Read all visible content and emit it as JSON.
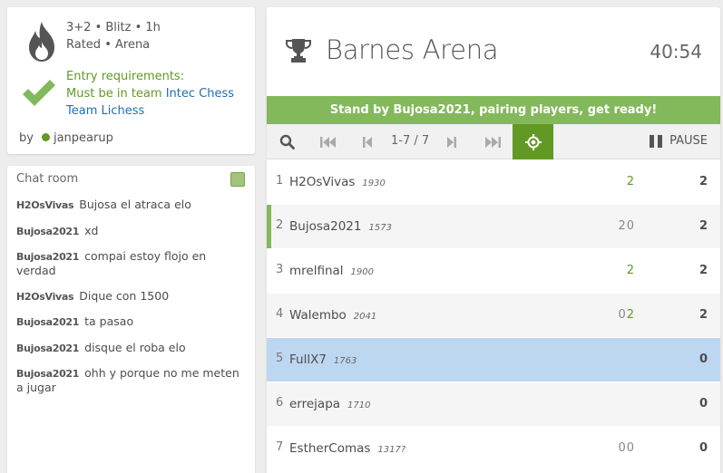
{
  "tournament": {
    "clock_line": "3+2 • Blitz • 1h",
    "mode_line": "Rated • Arena",
    "entry": {
      "label": "Entry requirements:",
      "prefix": "Must be in team",
      "team_line1": "Intec Chess",
      "team_line2": "Team Lichess"
    },
    "by_label": "by",
    "creator": "janpearup",
    "name": "Barnes Arena",
    "time_left": "40:54",
    "banner": "Stand by Bujosa2021, pairing players, get ready!",
    "page_info": "1-7 / 7",
    "pause_label": "PAUSE"
  },
  "chat": {
    "title": "Chat room",
    "messages": [
      {
        "user": "H2OsVivas",
        "text": "Bujosa el atraca elo"
      },
      {
        "user": "Bujosa2021",
        "text": "xd"
      },
      {
        "user": "Bujosa2021",
        "text": "compai estoy flojo en verdad"
      },
      {
        "user": "H2OsVivas",
        "text": "Dique con 1500"
      },
      {
        "user": "Bujosa2021",
        "text": "ta pasao"
      },
      {
        "user": "Bujosa2021",
        "text": "disque el roba elo"
      },
      {
        "user": "Bujosa2021",
        "text": "ohh y porque no me meten a jugar"
      }
    ]
  },
  "standings": [
    {
      "rank": "1",
      "name": "H2OsVivas",
      "rating": "1930",
      "sheet": "2",
      "score": "2"
    },
    {
      "rank": "2",
      "name": "Bujosa2021",
      "rating": "1573",
      "sheet": "20",
      "score": "2"
    },
    {
      "rank": "3",
      "name": "mrelfinal",
      "rating": "1900",
      "sheet": "2",
      "score": "2"
    },
    {
      "rank": "4",
      "name": "Walembo",
      "rating": "2041",
      "sheet": "02",
      "score": "2"
    },
    {
      "rank": "5",
      "name": "FullX7",
      "rating": "1763",
      "sheet": "",
      "score": "0"
    },
    {
      "rank": "6",
      "name": "errejapa",
      "rating": "1710",
      "sheet": "",
      "score": "0"
    },
    {
      "rank": "7",
      "name": "EstherComas",
      "rating": "1317?",
      "sheet": "00",
      "score": "0"
    }
  ],
  "colors": {
    "accent": "#629924",
    "banner": "#83b85b",
    "highlight": "#bdd7f1",
    "link": "#1f6fb2"
  },
  "icons": [
    "flame-icon",
    "checkmark-icon",
    "trophy-icon",
    "search-icon",
    "first-page-icon",
    "prev-page-icon",
    "next-page-icon",
    "last-page-icon",
    "crosshair-icon",
    "pause-icon"
  ]
}
